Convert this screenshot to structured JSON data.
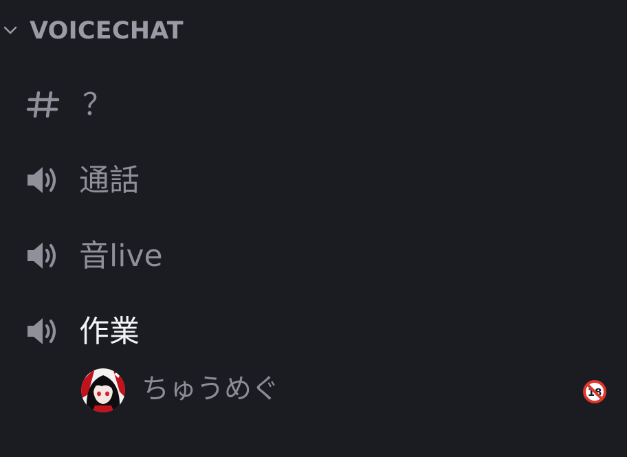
{
  "category": {
    "label": "VOICECHAT",
    "icon": "chevron-down-icon"
  },
  "channels": [
    {
      "name": "？",
      "type": "text",
      "icon": "hash-icon"
    },
    {
      "name": "通話",
      "type": "voice",
      "icon": "speaker-icon"
    },
    {
      "name": "音live",
      "type": "voice",
      "icon": "speaker-icon"
    },
    {
      "name": "作業",
      "type": "voice",
      "icon": "speaker-icon",
      "active": true
    }
  ],
  "voice_member": {
    "name": "ちゅうめぐ",
    "avatar": "avatar-image",
    "badge_icon": "no-under-18-icon",
    "badge_text": "18"
  },
  "colors": {
    "background": "#1b1c22",
    "muted_text": "#8f9099",
    "active_text": "#f2f3f5",
    "badge_red": "#e0362b"
  }
}
